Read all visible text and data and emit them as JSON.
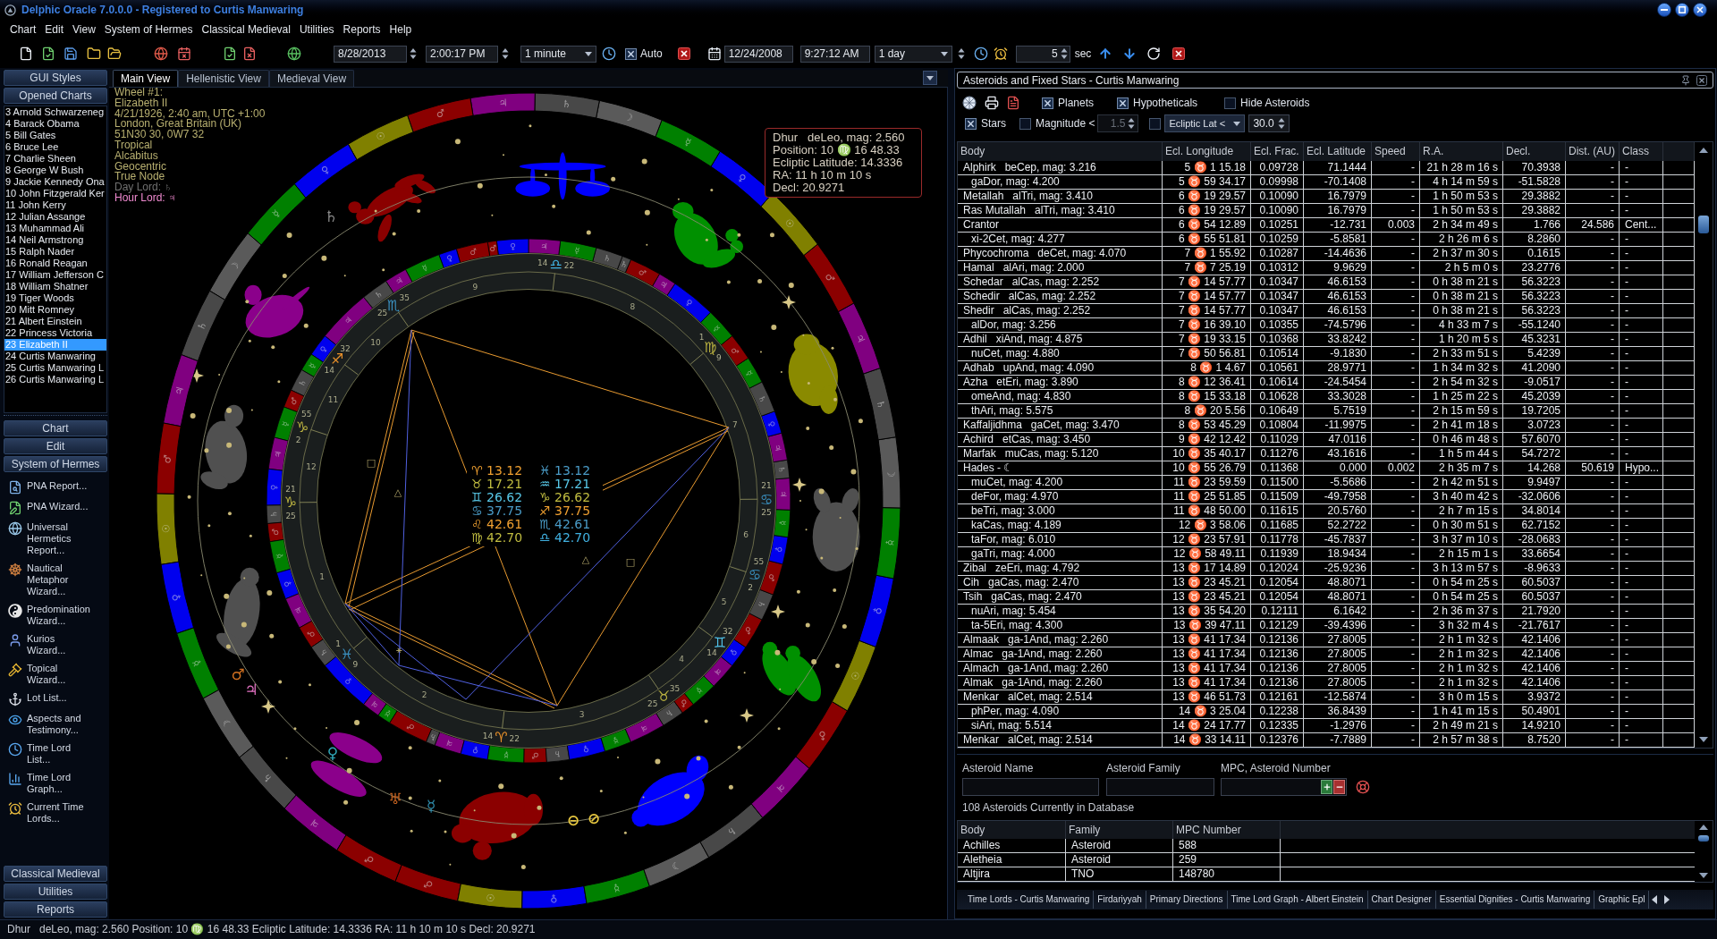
{
  "window": {
    "title": "Delphic Oracle 7.0.0.0 - Registered to Curtis Manwaring"
  },
  "menu": [
    "Chart",
    "Edit",
    "View",
    "System of Hermes",
    "Classical Medieval",
    "Utilities",
    "Reports",
    "Help"
  ],
  "toolbar": {
    "start_date": "8/28/2013",
    "start_time": "2:00:17 PM",
    "step": "1 minute",
    "auto": {
      "label": "Auto",
      "checked": true
    },
    "end_date": "12/24/2008",
    "end_time": "9:27:12 AM",
    "end_step": "1 day",
    "interval": "5",
    "interval_unit": "sec"
  },
  "sidebar": {
    "header_buttons": [
      "GUI Styles",
      "Opened Charts"
    ],
    "charts": [
      {
        "label": "3 Arnold Schwarzeneg",
        "selected": false
      },
      {
        "label": "4 Barack Obama",
        "selected": false
      },
      {
        "label": "5 Bill Gates",
        "selected": false
      },
      {
        "label": "6 Bruce Lee",
        "selected": false
      },
      {
        "label": "7 Charlie Sheen",
        "selected": false
      },
      {
        "label": "8 George W Bush",
        "selected": false
      },
      {
        "label": "9 Jackie Kennedy Ona",
        "selected": false
      },
      {
        "label": "10 John Fitzgerald Ker",
        "selected": false
      },
      {
        "label": "11 John Kerry",
        "selected": false
      },
      {
        "label": "12 Julian Assange",
        "selected": false
      },
      {
        "label": "13 Muhammad Ali",
        "selected": false
      },
      {
        "label": "14 Neil Armstrong",
        "selected": false
      },
      {
        "label": "15 Ralph Nader",
        "selected": false
      },
      {
        "label": "16 Ronald Reagan",
        "selected": false
      },
      {
        "label": "17 William Jefferson C",
        "selected": false
      },
      {
        "label": "18 William Shatner",
        "selected": false
      },
      {
        "label": "19 Tiger Woods",
        "selected": false
      },
      {
        "label": "20 Mitt Romney",
        "selected": false
      },
      {
        "label": "21 Albert Einstein",
        "selected": false
      },
      {
        "label": "22 Princess Victoria",
        "selected": false
      },
      {
        "label": "23 Elizabeth II",
        "selected": true
      },
      {
        "label": "24 Curtis Manwaring",
        "selected": false
      },
      {
        "label": "25 Curtis Manwaring L",
        "selected": false
      },
      {
        "label": "26 Curtis Manwaring L",
        "selected": false
      }
    ],
    "sections": [
      "Chart",
      "Edit",
      "System of Hermes"
    ],
    "tools": [
      "PNA Report...",
      "PNA Wizard...",
      "Universal Hermetics Report...",
      "Nautical Metaphor Wizard...",
      "Predomination Wizard...",
      "Kurios Wizard...",
      "Topical Wizard...",
      "Lot List...",
      "Aspects and Testimony...",
      "Time Lord List...",
      "Time Lord Graph...",
      "Current Time Lords..."
    ],
    "footer_sections": [
      "Classical Medieval",
      "Utilities",
      "Reports"
    ]
  },
  "chart_view": {
    "tabs": [
      {
        "label": "Main View",
        "selected": true
      },
      {
        "label": "Hellenistic View",
        "selected": false
      },
      {
        "label": "Medieval View",
        "selected": false
      }
    ],
    "info": [
      {
        "kind": "detail",
        "text": "Wheel #1:"
      },
      {
        "kind": "detail",
        "text": "Elizabeth II"
      },
      {
        "kind": "detail",
        "text": "4/21/1926, 2:40 am, UTC +1:00"
      },
      {
        "kind": "detail",
        "text": "London, Great Britain (UK)"
      },
      {
        "kind": "detail",
        "text": "51N30 30, 0W7 32"
      },
      {
        "kind": "detail",
        "text": "Tropical"
      },
      {
        "kind": "detail",
        "text": "Alcabitus"
      },
      {
        "kind": "detail",
        "text": "Geocentric"
      },
      {
        "kind": "detail",
        "text": "True Node"
      },
      {
        "kind": "day_lord",
        "text": "Day Lord: ♄"
      },
      {
        "kind": "hour_lord",
        "text": "Hour Lord: ♃"
      }
    ],
    "tooltip": [
      "Dhur   deLeo, mag: 2.560",
      "Position: 10 ♍ 16 48.33",
      "Ecliptic Latitude: 14.3336",
      "RA: 11 h 10 m 10 s",
      "Decl: 20.9271"
    ],
    "decans": [
      {
        "glyph": "♂",
        "color": "#8b0000"
      },
      {
        "glyph": "☉",
        "color": "#808000"
      },
      {
        "glyph": "♀",
        "color": "#0000ee"
      },
      {
        "glyph": "☿",
        "color": "#008000"
      },
      {
        "glyph": "☽",
        "color": "#5a5a5a"
      },
      {
        "glyph": "♄",
        "color": "#484848"
      },
      {
        "glyph": "♃",
        "color": "#800080"
      },
      {
        "glyph": "♂",
        "color": "#8b0000"
      },
      {
        "glyph": "☉",
        "color": "#808000"
      },
      {
        "glyph": "♀",
        "color": "#0000ee"
      },
      {
        "glyph": "☿",
        "color": "#008000"
      },
      {
        "glyph": "☽",
        "color": "#5a5a5a"
      },
      {
        "glyph": "♄",
        "color": "#484848"
      },
      {
        "glyph": "♃",
        "color": "#800080"
      },
      {
        "glyph": "♂",
        "color": "#8b0000"
      },
      {
        "glyph": "☉",
        "color": "#808000"
      },
      {
        "glyph": "♀",
        "color": "#0000ee"
      },
      {
        "glyph": "☿",
        "color": "#008000"
      },
      {
        "glyph": "☽",
        "color": "#5a5a5a"
      },
      {
        "glyph": "♄",
        "color": "#484848"
      },
      {
        "glyph": "♃",
        "color": "#800080"
      },
      {
        "glyph": "♂",
        "color": "#8b0000"
      },
      {
        "glyph": "☉",
        "color": "#808000"
      },
      {
        "glyph": "♀",
        "color": "#0000ee"
      },
      {
        "glyph": "☿",
        "color": "#008000"
      },
      {
        "glyph": "☽",
        "color": "#5a5a5a"
      },
      {
        "glyph": "♄",
        "color": "#484848"
      },
      {
        "glyph": "♃",
        "color": "#800080"
      },
      {
        "glyph": "♂",
        "color": "#8b0000"
      },
      {
        "glyph": "☉",
        "color": "#808000"
      },
      {
        "glyph": "♀",
        "color": "#0000ee"
      },
      {
        "glyph": "☿",
        "color": "#008000"
      },
      {
        "glyph": "☽",
        "color": "#5a5a5a"
      },
      {
        "glyph": "♄",
        "color": "#484848"
      },
      {
        "glyph": "♃",
        "color": "#800080"
      },
      {
        "glyph": "♂",
        "color": "#8b0000"
      }
    ],
    "terms": [
      {
        "glyph": "♃",
        "color": "#800080"
      },
      {
        "glyph": "♀",
        "color": "#0000ee"
      },
      {
        "glyph": "☿",
        "color": "#008000"
      },
      {
        "glyph": "♂",
        "color": "#8b0000"
      },
      {
        "glyph": "♄",
        "color": "#484848"
      },
      {
        "glyph": "♀",
        "color": "#0000ee"
      },
      {
        "glyph": "☿",
        "color": "#008000"
      },
      {
        "glyph": "♃",
        "color": "#800080"
      },
      {
        "glyph": "♄",
        "color": "#484848"
      },
      {
        "glyph": "♂",
        "color": "#8b0000"
      },
      {
        "glyph": "☿",
        "color": "#008000"
      },
      {
        "glyph": "♃",
        "color": "#800080"
      },
      {
        "glyph": "♀",
        "color": "#0000ee"
      },
      {
        "glyph": "♂",
        "color": "#8b0000"
      },
      {
        "glyph": "♄",
        "color": "#484848"
      },
      {
        "glyph": "♂",
        "color": "#8b0000"
      },
      {
        "glyph": "♀",
        "color": "#0000ee"
      },
      {
        "glyph": "☿",
        "color": "#008000"
      },
      {
        "glyph": "♃",
        "color": "#800080"
      },
      {
        "glyph": "♄",
        "color": "#484848"
      },
      {
        "glyph": "♃",
        "color": "#800080"
      },
      {
        "glyph": "♀",
        "color": "#0000ee"
      },
      {
        "glyph": "♄",
        "color": "#484848"
      },
      {
        "glyph": "☿",
        "color": "#008000"
      },
      {
        "glyph": "♂",
        "color": "#8b0000"
      },
      {
        "glyph": "☿",
        "color": "#008000"
      },
      {
        "glyph": "♀",
        "color": "#0000ee"
      },
      {
        "glyph": "♃",
        "color": "#800080"
      },
      {
        "glyph": "♂",
        "color": "#8b0000"
      },
      {
        "glyph": "♄",
        "color": "#484848"
      },
      {
        "glyph": "♄",
        "color": "#484848"
      },
      {
        "glyph": "☿",
        "color": "#008000"
      },
      {
        "glyph": "♃",
        "color": "#800080"
      },
      {
        "glyph": "♀",
        "color": "#0000ee"
      },
      {
        "glyph": "♂",
        "color": "#8b0000"
      },
      {
        "glyph": "♂",
        "color": "#8b0000"
      },
      {
        "glyph": "♀",
        "color": "#0000ee"
      },
      {
        "glyph": "☿",
        "color": "#008000"
      },
      {
        "glyph": "♃",
        "color": "#800080"
      },
      {
        "glyph": "♄",
        "color": "#484848"
      },
      {
        "glyph": "♃",
        "color": "#800080"
      },
      {
        "glyph": "♀",
        "color": "#0000ee"
      },
      {
        "glyph": "☿",
        "color": "#008000"
      },
      {
        "glyph": "♄",
        "color": "#484848"
      },
      {
        "glyph": "♂",
        "color": "#8b0000"
      },
      {
        "glyph": "☿",
        "color": "#008000"
      },
      {
        "glyph": "♃",
        "color": "#800080"
      },
      {
        "glyph": "♀",
        "color": "#0000ee"
      },
      {
        "glyph": "♄",
        "color": "#484848"
      },
      {
        "glyph": "♂",
        "color": "#8b0000"
      },
      {
        "glyph": "☿",
        "color": "#008000"
      },
      {
        "glyph": "♀",
        "color": "#0000ee"
      },
      {
        "glyph": "♃",
        "color": "#800080"
      },
      {
        "glyph": "♂",
        "color": "#8b0000"
      },
      {
        "glyph": "♄",
        "color": "#484848"
      },
      {
        "glyph": "♀",
        "color": "#0000ee"
      },
      {
        "glyph": "♃",
        "color": "#800080"
      },
      {
        "glyph": "☿",
        "color": "#008000"
      },
      {
        "glyph": "♂",
        "color": "#8b0000"
      },
      {
        "glyph": "♄",
        "color": "#484848"
      }
    ],
    "cusps": [
      {
        "degree": "21",
        "sign": "♑",
        "minute": "25",
        "color": "#b8b040"
      },
      {
        "degree": "1",
        "sign": "♓",
        "minute": "9",
        "color": "#3a90c0"
      },
      {
        "degree": "14",
        "sign": "♈",
        "minute": "22",
        "color": "#e8902a"
      },
      {
        "degree": "25",
        "sign": "♉",
        "minute": "35",
        "color": "#b8b040"
      },
      {
        "degree": "14",
        "sign": "♊",
        "minute": "32",
        "color": "#50c0e8"
      },
      {
        "degree": "2",
        "sign": "♋",
        "minute": "55",
        "color": "#3a90c0"
      },
      {
        "degree": "21",
        "sign": "♋",
        "minute": "25",
        "color": "#3a90c0"
      },
      {
        "degree": "1",
        "sign": "♍",
        "minute": "9",
        "color": "#b8b040"
      },
      {
        "degree": "14",
        "sign": "♎",
        "minute": "22",
        "color": "#40b0e0"
      },
      {
        "degree": "25",
        "sign": "♏",
        "minute": "35",
        "color": "#3a90c0"
      },
      {
        "degree": "14",
        "sign": "♐",
        "minute": "32",
        "color": "#e8902a"
      },
      {
        "degree": "2",
        "sign": "♑",
        "minute": "55",
        "color": "#b8b040"
      }
    ],
    "house_numbers": [
      "1",
      "2",
      "3",
      "4",
      "5",
      "6",
      "7",
      "8",
      "9",
      "10",
      "11",
      "12"
    ],
    "aspect_marks": [
      "□",
      "△",
      "△",
      "□",
      "⚹"
    ],
    "readings": [
      {
        "text": "♈ 13.12",
        "color": "#f0a030"
      },
      {
        "text": "♓ 13.12",
        "color": "#4a9cc8"
      },
      {
        "text": "♉ 17.21",
        "color": "#c0bc40"
      },
      {
        "text": "♒ 17.21",
        "color": "#58c8e8"
      },
      {
        "text": "♊ 26.62",
        "color": "#58c8e8"
      },
      {
        "text": "♑ 26.62",
        "color": "#c0bc40"
      },
      {
        "text": "♋ 37.75",
        "color": "#4a9cc8"
      },
      {
        "text": "♐ 37.75",
        "color": "#f0a030"
      },
      {
        "text": "♌ 42.61",
        "color": "#f0a030"
      },
      {
        "text": "♏ 42.61",
        "color": "#4a9cc8"
      },
      {
        "text": "♍ 42.70",
        "color": "#c0bc40"
      },
      {
        "text": "♎ 42.70",
        "color": "#40b0e0"
      }
    ],
    "planets": [
      {
        "glyph": "♄",
        "color": "#8a8a8a"
      },
      {
        "glyph": "♂",
        "color": "#d07020"
      },
      {
        "glyph": "♃",
        "color": "#e070c0"
      },
      {
        "glyph": "♀",
        "color": "#30a8b8"
      },
      {
        "glyph": "♅",
        "color": "#c06020"
      },
      {
        "glyph": "☿",
        "color": "#3090b0"
      },
      {
        "glyph": "⊖",
        "color": "#e8c840"
      },
      {
        "glyph": "⊘",
        "color": "#e8c840"
      }
    ]
  },
  "asteroid_panel": {
    "title": "Asteroids and Fixed Stars - Curtis Manwaring",
    "options": [
      {
        "label": "Planets",
        "checked": true
      },
      {
        "label": "Hypotheticals",
        "checked": true
      },
      {
        "label": "Hide Asteroids",
        "checked": false
      },
      {
        "label": "Stars",
        "checked": true
      },
      {
        "label": "Magnitude <",
        "checked": false
      }
    ],
    "magnitude": {
      "value": "1.5",
      "disabled": true
    },
    "filter": {
      "checked": false,
      "mode": "Ecliptic Lat <",
      "value": "30.0"
    },
    "table": {
      "columns": [
        "Body",
        "Ecl. Longitude",
        "Ecl. Frac.",
        "Ecl. Latitude",
        "Speed",
        "R.A.",
        "Decl.",
        "Dist. (AU)",
        "Class"
      ],
      "rows": [
        {
          "kind": "named",
          "cells": [
            "Alphirk   beCep, mag: 3.216",
            "5 ♉ 1 15.18",
            "0.09728",
            "71.1444",
            "-",
            "21 h 28 m 16 s",
            "70.3938",
            "-",
            "-"
          ]
        },
        {
          "kind": "unnamed",
          "cells": [
            "gaDor, mag: 4.200",
            "5 ♉ 59 34.17",
            "0.09998",
            "-70.1408",
            "-",
            "4 h 14 m 59 s",
            "-51.5828",
            "-",
            "-"
          ]
        },
        {
          "kind": "named",
          "cells": [
            "Metallah   alTri, mag: 3.410",
            "6 ♉ 19 29.57",
            "0.10090",
            "16.7979",
            "-",
            "1 h 50 m 53 s",
            "29.3882",
            "-",
            "-"
          ]
        },
        {
          "kind": "named",
          "cells": [
            "Ras Mutallah   alTri, mag: 3.410",
            "6 ♉ 19 29.57",
            "0.10090",
            "16.7979",
            "-",
            "1 h 50 m 53 s",
            "29.3882",
            "-",
            "-"
          ]
        },
        {
          "kind": "named",
          "cells": [
            "Crantor",
            "6 ♉ 54 12.89",
            "0.10251",
            "-12.731",
            "0.003",
            "2 h 34 m 49 s",
            "1.766",
            "24.586",
            "Cent..."
          ]
        },
        {
          "kind": "unnamed",
          "cells": [
            "xi-2Cet, mag: 4.277",
            "6 ♉ 55 51.81",
            "0.10259",
            "-5.8581",
            "-",
            "2 h 26 m 6 s",
            "8.2860",
            "-",
            "-"
          ]
        },
        {
          "kind": "named",
          "cells": [
            "Phycochroma   deCet, mag: 4.070",
            "7 ♉ 1 55.92",
            "0.10287",
            "-14.4636",
            "-",
            "2 h 37 m 30 s",
            "0.1615",
            "-",
            "-"
          ]
        },
        {
          "kind": "named",
          "cells": [
            "Hamal   alAri, mag: 2.000",
            "7 ♉ 7 25.19",
            "0.10312",
            "9.9629",
            "-",
            "2 h 5 m 0 s",
            "23.2776",
            "-",
            "-"
          ]
        },
        {
          "kind": "named",
          "cells": [
            "Schedar   alCas, mag: 2.252",
            "7 ♉ 14 57.77",
            "0.10347",
            "46.6153",
            "-",
            "0 h 38 m 21 s",
            "56.3223",
            "-",
            "-"
          ]
        },
        {
          "kind": "named",
          "cells": [
            "Schedir   alCas, mag: 2.252",
            "7 ♉ 14 57.77",
            "0.10347",
            "46.6153",
            "-",
            "0 h 38 m 21 s",
            "56.3223",
            "-",
            "-"
          ]
        },
        {
          "kind": "named",
          "cells": [
            "Shedir   alCas, mag: 2.252",
            "7 ♉ 14 57.77",
            "0.10347",
            "46.6153",
            "-",
            "0 h 38 m 21 s",
            "56.3223",
            "-",
            "-"
          ]
        },
        {
          "kind": "unnamed",
          "cells": [
            "alDor, mag: 3.256",
            "7 ♉ 16 39.10",
            "0.10355",
            "-74.5796",
            "-",
            "4 h 33 m 7 s",
            "-55.1240",
            "-",
            "-"
          ]
        },
        {
          "kind": "named",
          "cells": [
            "Adhil   xiAnd, mag: 4.875",
            "7 ♉ 19 33.15",
            "0.10368",
            "33.8242",
            "-",
            "1 h 20 m 5 s",
            "45.3231",
            "-",
            "-"
          ]
        },
        {
          "kind": "unnamed",
          "cells": [
            "nuCet, mag: 4.880",
            "7 ♉ 50 56.81",
            "0.10514",
            "-9.1830",
            "-",
            "2 h 33 m 51 s",
            "5.4239",
            "-",
            "-"
          ]
        },
        {
          "kind": "named",
          "cells": [
            "Adhab   upAnd, mag: 4.090",
            "8 ♉ 1 4.67",
            "0.10561",
            "28.9771",
            "-",
            "1 h 34 m 32 s",
            "41.2090",
            "-",
            "-"
          ]
        },
        {
          "kind": "named",
          "cells": [
            "Azha   etEri, mag: 3.890",
            "8 ♉ 12 36.41",
            "0.10614",
            "-24.5454",
            "-",
            "2 h 54 m 32 s",
            "-9.0517",
            "-",
            "-"
          ]
        },
        {
          "kind": "unnamed",
          "cells": [
            "omeAnd, mag: 4.830",
            "8 ♉ 15 33.18",
            "0.10628",
            "33.3028",
            "-",
            "1 h 25 m 22 s",
            "45.2039",
            "-",
            "-"
          ]
        },
        {
          "kind": "unnamed",
          "cells": [
            "thAri, mag: 5.575",
            "8 ♉ 20 5.56",
            "0.10649",
            "5.7519",
            "-",
            "2 h 15 m 59 s",
            "19.7205",
            "-",
            "-"
          ]
        },
        {
          "kind": "named",
          "cells": [
            "Kaffaljidhma   gaCet, mag: 3.470",
            "8 ♉ 53 45.29",
            "0.10804",
            "-11.9975",
            "-",
            "2 h 41 m 18 s",
            "3.0723",
            "-",
            "-"
          ]
        },
        {
          "kind": "named",
          "cells": [
            "Achird   etCas, mag: 3.450",
            "9 ♉ 42 12.42",
            "0.11029",
            "47.0116",
            "-",
            "0 h 46 m 48 s",
            "57.6070",
            "-",
            "-"
          ]
        },
        {
          "kind": "named",
          "cells": [
            "Marfak   muCas, mag: 5.120",
            "10 ♉ 35 40.17",
            "0.11276",
            "43.1616",
            "-",
            "1 h 5 m 44 s",
            "54.7272",
            "-",
            "-"
          ]
        },
        {
          "kind": "named",
          "cells": [
            "Hades - ☾",
            "10 ♉ 55 26.79",
            "0.11368",
            "0.000",
            "0.002",
            "2 h 35 m 7 s",
            "14.268",
            "50.619",
            "Hypo..."
          ]
        },
        {
          "kind": "unnamed",
          "cells": [
            "muCet, mag: 4.200",
            "11 ♉ 23 59.59",
            "0.11500",
            "-5.5686",
            "-",
            "2 h 42 m 51 s",
            "9.9497",
            "-",
            "-"
          ]
        },
        {
          "kind": "unnamed",
          "cells": [
            "deFor, mag: 4.970",
            "11 ♉ 25 51.85",
            "0.11509",
            "-49.7958",
            "-",
            "3 h 40 m 42 s",
            "-32.0606",
            "-",
            "-"
          ]
        },
        {
          "kind": "unnamed",
          "cells": [
            "beTri, mag: 3.000",
            "11 ♉ 48 50.00",
            "0.11615",
            "20.5760",
            "-",
            "2 h 7 m 15 s",
            "34.8014",
            "-",
            "-"
          ]
        },
        {
          "kind": "unnamed",
          "cells": [
            "kaCas, mag: 4.189",
            "12 ♉ 3 58.06",
            "0.11685",
            "52.2722",
            "-",
            "0 h 30 m 51 s",
            "62.7152",
            "-",
            "-"
          ]
        },
        {
          "kind": "unnamed",
          "cells": [
            "taFor, mag: 6.010",
            "12 ♉ 23 57.91",
            "0.11778",
            "-45.7837",
            "-",
            "3 h 37 m 10 s",
            "-28.0683",
            "-",
            "-"
          ]
        },
        {
          "kind": "unnamed",
          "cells": [
            "gaTri, mag: 4.000",
            "12 ♉ 58 49.11",
            "0.11939",
            "18.9434",
            "-",
            "2 h 15 m 1 s",
            "33.6654",
            "-",
            "-"
          ]
        },
        {
          "kind": "named",
          "cells": [
            "Zibal   zeEri, mag: 4.792",
            "13 ♉ 17 14.89",
            "0.12024",
            "-25.9236",
            "-",
            "3 h 13 m 57 s",
            "-8.9633",
            "-",
            "-"
          ]
        },
        {
          "kind": "named",
          "cells": [
            "Cih   gaCas, mag: 2.470",
            "13 ♉ 23 45.21",
            "0.12054",
            "48.8071",
            "-",
            "0 h 54 m 25 s",
            "60.5037",
            "-",
            "-"
          ]
        },
        {
          "kind": "named",
          "cells": [
            "Tsih   gaCas, mag: 2.470",
            "13 ♉ 23 45.21",
            "0.12054",
            "48.8071",
            "-",
            "0 h 54 m 25 s",
            "60.5037",
            "-",
            "-"
          ]
        },
        {
          "kind": "unnamed",
          "cells": [
            "nuAri, mag: 5.454",
            "13 ♉ 35 54.20",
            "0.12111",
            "6.1642",
            "-",
            "2 h 36 m 37 s",
            "21.7920",
            "-",
            "-"
          ]
        },
        {
          "kind": "unnamed",
          "cells": [
            "ta-5Eri, mag: 4.300",
            "13 ♉ 39 47.11",
            "0.12129",
            "-39.4396",
            "-",
            "3 h 32 m 4 s",
            "-21.7617",
            "-",
            "-"
          ]
        },
        {
          "kind": "named",
          "cells": [
            "Almaak   ga-1And, mag: 2.260",
            "13 ♉ 41 17.34",
            "0.12136",
            "27.8005",
            "-",
            "2 h 1 m 32 s",
            "42.1406",
            "-",
            "-"
          ]
        },
        {
          "kind": "named",
          "cells": [
            "Almac   ga-1And, mag: 2.260",
            "13 ♉ 41 17.34",
            "0.12136",
            "27.8005",
            "-",
            "2 h 1 m 32 s",
            "42.1406",
            "-",
            "-"
          ]
        },
        {
          "kind": "named",
          "cells": [
            "Almach   ga-1And, mag: 2.260",
            "13 ♉ 41 17.34",
            "0.12136",
            "27.8005",
            "-",
            "2 h 1 m 32 s",
            "42.1406",
            "-",
            "-"
          ]
        },
        {
          "kind": "named",
          "cells": [
            "Almak   ga-1And, mag: 2.260",
            "13 ♉ 41 17.34",
            "0.12136",
            "27.8005",
            "-",
            "2 h 1 m 32 s",
            "42.1406",
            "-",
            "-"
          ]
        },
        {
          "kind": "named",
          "cells": [
            "Menkar   alCet, mag: 2.514",
            "13 ♉ 46 51.73",
            "0.12161",
            "-12.5874",
            "-",
            "3 h 0 m 15 s",
            "3.9372",
            "-",
            "-"
          ]
        },
        {
          "kind": "unnamed",
          "cells": [
            "phPer, mag: 4.090",
            "14 ♉ 3 25.04",
            "0.12238",
            "36.8439",
            "-",
            "1 h 41 m 15 s",
            "50.4901",
            "-",
            "-"
          ]
        },
        {
          "kind": "unnamed",
          "cells": [
            "siAri, mag: 5.514",
            "14 ♉ 24 17.77",
            "0.12335",
            "-1.2976",
            "-",
            "2 h 49 m 21 s",
            "14.9210",
            "-",
            "-"
          ]
        },
        {
          "kind": "named",
          "cells": [
            "Menkar   alCet, mag: 2.514",
            "14 ♉ 33 14.11",
            "0.12376",
            "-7.7889",
            "-",
            "2 h 57 m 38 s",
            "8.7520",
            "-",
            "-"
          ]
        }
      ]
    },
    "search": {
      "fields": [
        "Asteroid Name",
        "Asteroid Family",
        "MPC, Asteroid Number"
      ],
      "count": "108 Asteroids Currently in Database"
    },
    "asteroids": {
      "columns": [
        "Body",
        "Family",
        "MPC Number"
      ],
      "rows": [
        [
          "Achilles",
          "Asteroid",
          "588"
        ],
        [
          "Aletheia",
          "Asteroid",
          "259"
        ],
        [
          "Altjira",
          "TNO",
          "148780"
        ]
      ]
    },
    "tabs": [
      "Time Lords - Curtis Manwaring",
      "Firdariyyah",
      "Primary Directions",
      "Time Lord Graph - Albert Einstein",
      "Chart Designer",
      "Essential Dignities - Curtis Manwaring",
      "Graphic Epl"
    ]
  },
  "status_bar": "Dhur   deLeo, mag: 2.560 Position: 10 ♍ 16 48.33 Ecliptic Latitude: 14.3336 RA: 11 h 10 m 10 s Decl: 20.9271"
}
